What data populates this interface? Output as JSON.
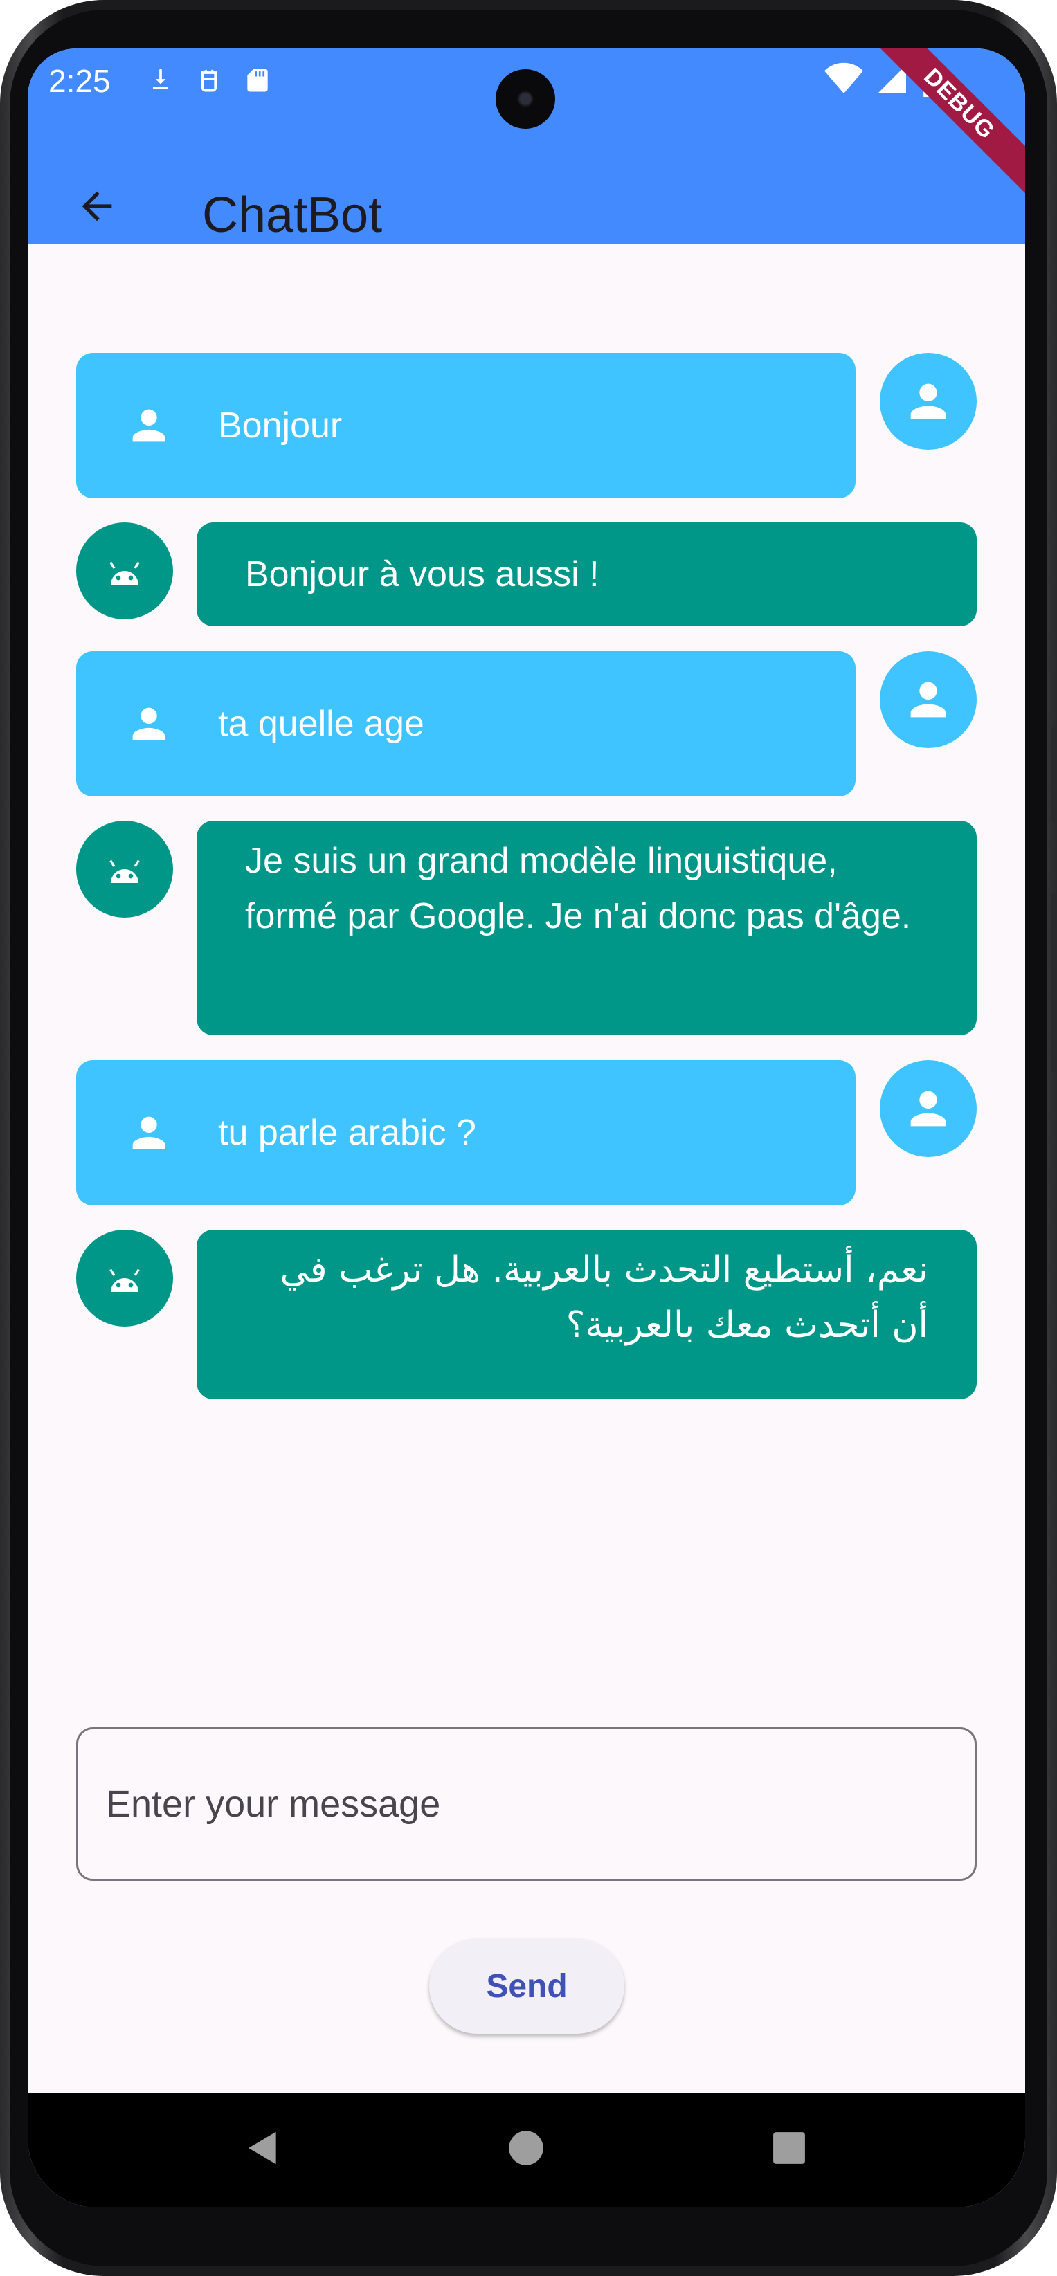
{
  "status_bar": {
    "time": "2:25",
    "debug_label": "DEBUG"
  },
  "app_bar": {
    "title": "ChatBot",
    "color": "#448aff"
  },
  "messages": [
    {
      "sender": "user",
      "text": "Bonjour"
    },
    {
      "sender": "bot",
      "text": "Bonjour à vous aussi !"
    },
    {
      "sender": "user",
      "text": "ta quelle age"
    },
    {
      "sender": "bot",
      "text": "Je suis un grand modèle linguistique, formé par Google. Je n'ai donc pas d'âge."
    },
    {
      "sender": "user",
      "text": "tu parle arabic ?"
    },
    {
      "sender": "bot",
      "text": "نعم، أستطيع التحدث بالعربية. هل ترغب في أن أتحدث معك بالعربية؟"
    }
  ],
  "colors": {
    "user_bubble": "#40c4ff",
    "bot_bubble": "#009688",
    "send_text": "#3f51b5"
  },
  "composer": {
    "placeholder": "Enter your message",
    "value": "",
    "send_label": "Send"
  },
  "icons": {
    "back": "arrow-back-icon",
    "user_avatar": "person-icon",
    "bot_avatar": "android-icon",
    "nav": [
      "back-triangle-icon",
      "home-circle-icon",
      "recents-square-icon"
    ]
  }
}
